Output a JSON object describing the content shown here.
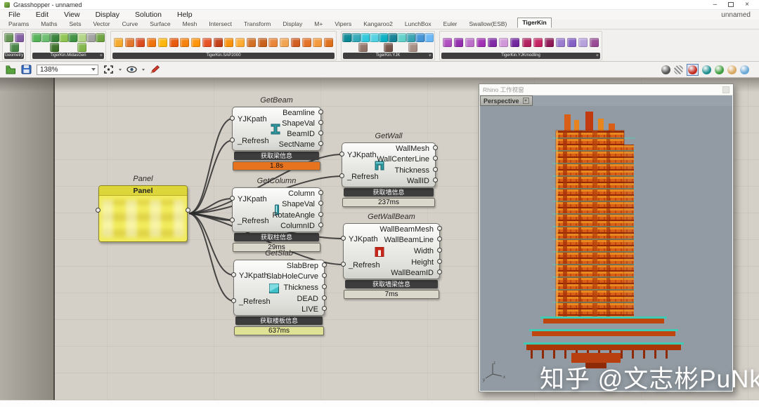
{
  "window": {
    "title": "Grasshopper - unnamed",
    "minimize_glyph": "–",
    "close_glyph": "×",
    "menubar_right_label": "unnamed"
  },
  "menu": {
    "items": [
      "File",
      "Edit",
      "View",
      "Display",
      "Solution",
      "Help"
    ]
  },
  "tabs": {
    "items": [
      "Params",
      "Maths",
      "Sets",
      "Vector",
      "Curve",
      "Surface",
      "Mesh",
      "Intersect",
      "Transform",
      "Display",
      "M+",
      "Vipers",
      "Kangaroo2",
      "LunchBox",
      "Euler",
      "Swallow(ESB)",
      "TigerKin"
    ],
    "active": "TigerKin"
  },
  "toolbar": {
    "groups": [
      {
        "label": "Geometry",
        "plus": false,
        "icon_name": "geometry-tool-icon",
        "icons": [
          "#5e8f4f",
          "#7e57a0",
          "#3d7f3d"
        ]
      },
      {
        "label": "TigerKin.MidasGen",
        "plus": true,
        "icon_name": "midasgen-tool-icon",
        "icons": [
          "#4caf50",
          "#66bb6a",
          "#2e7d32",
          "#8bc34a",
          "#388e3c",
          "#aed581",
          "#9e9e9e",
          "#689f38",
          "#33691e",
          "#7cb342"
        ]
      },
      {
        "label": "TigerKin.SAP2000",
        "plus": false,
        "icon_name": "sap2000-tool-icon",
        "icons": [
          "#f5a623",
          "#e07020",
          "#d84315",
          "#ef6c00",
          "#ffb300",
          "#e65100",
          "#f57c00",
          "#ff8f00",
          "#e64a19",
          "#bf360c",
          "#fb8c00",
          "#ffa726",
          "#d1691a",
          "#c65a10",
          "#e88030",
          "#f2a048",
          "#cf5515",
          "#e36c1c",
          "#f49432",
          "#dd6a12"
        ]
      },
      {
        "label": "TigerKin.YJK",
        "plus": true,
        "icon_name": "yjk-tool-icon",
        "icons": [
          "#00838f",
          "#2aa6b5",
          "#26c6da",
          "#4dd0e1",
          "#00acc1",
          "#0a7c91",
          "#5ad0c8",
          "#2f9fae",
          "#3a8fd5",
          "#64b5f6",
          "#8d6e63",
          "#6d4c41",
          "#a2887e"
        ]
      },
      {
        "label": "TigerKin.YJKmodling",
        "plus": true,
        "icon_name": "yjkmodling-tool-icon",
        "icons": [
          "#ab47bc",
          "#8e24aa",
          "#ba68c8",
          "#9c27b0",
          "#7b1fa2",
          "#ce93d8",
          "#6a1b9a",
          "#ad1457",
          "#c2185b",
          "#880e4f",
          "#9575cd",
          "#7e57c2",
          "#b39ddb",
          "#93428f"
        ]
      }
    ]
  },
  "canvas_toolbar": {
    "zoom_value": "138%",
    "display_spheres": [
      {
        "color": "#555555",
        "striped": false,
        "selected": false
      },
      {
        "color": "#b9b9b9",
        "striped": true,
        "selected": false
      },
      {
        "color": "#c42a1e",
        "striped": false,
        "selected": true
      },
      {
        "color": "#1d8f8f",
        "striped": false,
        "selected": false
      },
      {
        "color": "#3f9e3f",
        "striped": false,
        "selected": false
      },
      {
        "color": "#d8a860",
        "striped": false,
        "selected": false
      },
      {
        "color": "#6aa8d8",
        "striped": false,
        "selected": false
      }
    ]
  },
  "components": {
    "panel": {
      "label": "Panel",
      "title": "Panel"
    },
    "get_beam": {
      "label": "GetBeam",
      "inputs": [
        "YJKpath",
        "_Refresh"
      ],
      "outputs": [
        "Beamline",
        "ShapeVal",
        "BeamID",
        "SectName"
      ],
      "caption": "获取梁信息",
      "runtime": "1.8s",
      "runtime_color": "#e8731f"
    },
    "get_column": {
      "label": "GetColumn",
      "inputs": [
        "YJKpath",
        "_Refresh"
      ],
      "outputs": [
        "Column",
        "ShapeVal",
        "RotateAngle",
        "ColumnID"
      ],
      "caption": "获取柱信息",
      "runtime": "29ms",
      "runtime_color": "#dad7cb"
    },
    "get_slab": {
      "label": "GetSlab",
      "inputs": [
        "YJKpath",
        "_Refresh"
      ],
      "outputs": [
        "SlabBrep",
        "SlabHoleCurve",
        "Thickness",
        "DEAD",
        "LIVE"
      ],
      "caption": "获取楼板信息",
      "runtime": "637ms",
      "runtime_color": "#dfe195"
    },
    "get_wall": {
      "label": "GetWall",
      "inputs": [
        "YJKpath",
        "_Refresh"
      ],
      "outputs": [
        "WallMesh",
        "WallCenterLine",
        "Thickness",
        "WallID"
      ],
      "caption": "获取墙信息",
      "runtime": "237ms",
      "runtime_color": "#dad7cb"
    },
    "get_wall_beam": {
      "label": "GetWallBeam",
      "inputs": [
        "YJKpath",
        "_Refresh"
      ],
      "outputs": [
        "WallBeamMesh",
        "WallBeamLine",
        "Width",
        "Height",
        "WallBeamID"
      ],
      "caption": "获取墙梁信息",
      "runtime": "7ms",
      "runtime_color": "#dad7cb"
    }
  },
  "viewport": {
    "title": "Rhino 工作视窗",
    "tab": "Perspective",
    "axis": {
      "x": "x",
      "y": "y",
      "z": "z"
    }
  },
  "watermark": "知乎 @文志彬PuNk",
  "colors": {
    "canvas_bg": "#d4d0c7",
    "caption_bg": "#3d3d3d",
    "panel_yellow": "#f2ec5c",
    "viewport_bg": "#929ba3",
    "model_orange": "#d95f17",
    "model_dark_red": "#8f2606",
    "model_teal": "#3fccb5",
    "wire": "#2b2b2b"
  }
}
